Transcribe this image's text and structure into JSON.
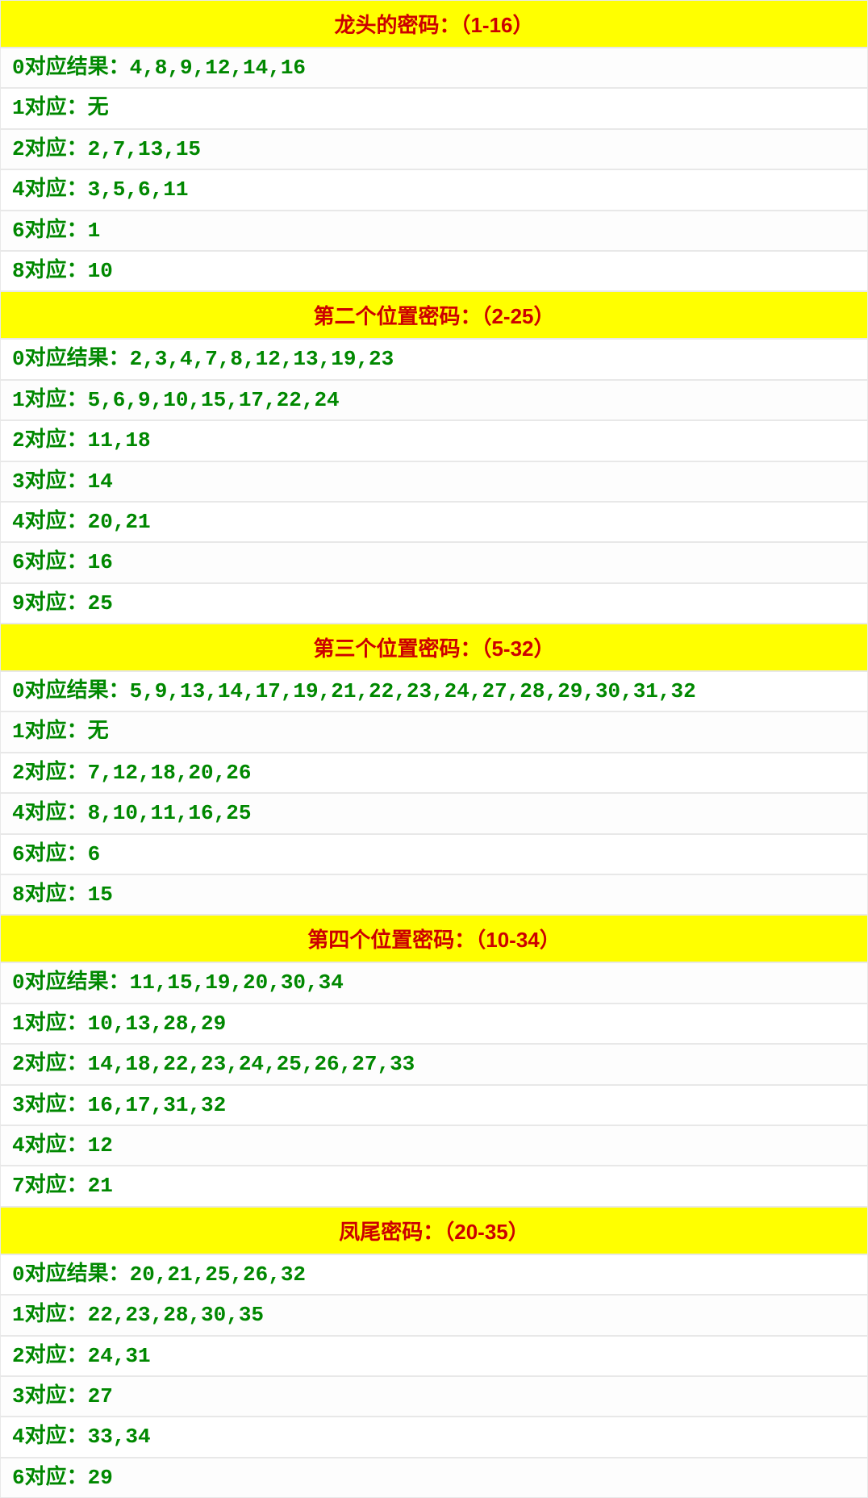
{
  "sections": [
    {
      "title": "龙头的密码：（1-16）",
      "rows": [
        "0对应结果：4,8,9,12,14,16",
        "1对应：无",
        "2对应：2,7,13,15",
        "4对应：3,5,6,11",
        "6对应：1",
        "8对应：10"
      ]
    },
    {
      "title": "第二个位置密码：（2-25）",
      "rows": [
        "0对应结果：2,3,4,7,8,12,13,19,23",
        "1对应：5,6,9,10,15,17,22,24",
        "2对应：11,18",
        "3对应：14",
        "4对应：20,21",
        "6对应：16",
        "9对应：25"
      ]
    },
    {
      "title": "第三个位置密码：（5-32）",
      "rows": [
        "0对应结果：5,9,13,14,17,19,21,22,23,24,27,28,29,30,31,32",
        "1对应：无",
        "2对应：7,12,18,20,26",
        "4对应：8,10,11,16,25",
        "6对应：6",
        "8对应：15"
      ]
    },
    {
      "title": "第四个位置密码：（10-34）",
      "rows": [
        "0对应结果：11,15,19,20,30,34",
        "1对应：10,13,28,29",
        "2对应：14,18,22,23,24,25,26,27,33",
        "3对应：16,17,31,32",
        "4对应：12",
        "7对应：21"
      ]
    },
    {
      "title": "凤尾密码：（20-35）",
      "rows": [
        "0对应结果：20,21,25,26,32",
        "1对应：22,23,28,30,35",
        "2对应：24,31",
        "3对应：27",
        "4对应：33,34",
        "6对应：29"
      ]
    }
  ]
}
